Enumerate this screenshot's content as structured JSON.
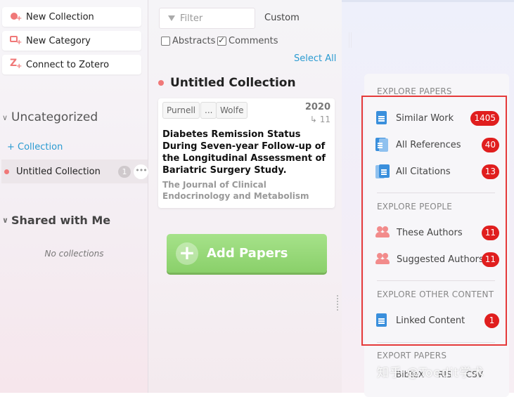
{
  "sidebar": {
    "new_collection": "New Collection",
    "new_category": "New Category",
    "connect_zotero": "Connect to Zotero",
    "uncategorized": "Uncategorized",
    "add_collection": "+ Collection",
    "collection_name": "Untitled Collection",
    "collection_count": "1",
    "collection_more": "•••",
    "shared_with_me": "Shared with Me",
    "no_collections": "No collections"
  },
  "middle": {
    "filter_placeholder": "Filter",
    "custom": "Custom",
    "abstracts": "Abstracts",
    "abstracts_checked": false,
    "comments": "Comments",
    "comments_checked": true,
    "select_all": "Select All",
    "collection_title": "Untitled Collection",
    "paper": {
      "author_first": "Purnell",
      "author_ellipsis": "...",
      "author_last": "Wolfe",
      "year": "2020",
      "citations": "11",
      "title": "Diabetes Remission Status During Seven-year Follow-up of the Longitudinal Assessment of Bariatric Surgery Study.",
      "journal": "The Journal of Clinical Endocrinology and Metabolism"
    },
    "add_papers": "Add Papers"
  },
  "explore": {
    "papers_header": "EXPLORE PAPERS",
    "similar_work": "Similar Work",
    "similar_work_count": "1405",
    "all_references": "All References",
    "all_references_count": "40",
    "all_citations": "All Citations",
    "all_citations_count": "13",
    "people_header": "EXPLORE PEOPLE",
    "these_authors": "These Authors",
    "these_authors_count": "11",
    "suggested_authors": "Suggested Authors",
    "suggested_authors_count": "11",
    "other_header": "EXPLORE OTHER CONTENT",
    "linked_content": "Linked Content",
    "linked_content_count": "1",
    "export_header": "EXPORT PAPERS",
    "export_bibtex": "BibTeX",
    "export_ris": "RIS",
    "export_csv": "CSV"
  },
  "watermark": "知乎 @Toedit学术",
  "colors": {
    "accent_red": "#e01e1e",
    "link_blue": "#2a9bd1",
    "add_green": "#8ad06a",
    "collection_dot": "#f07878"
  }
}
